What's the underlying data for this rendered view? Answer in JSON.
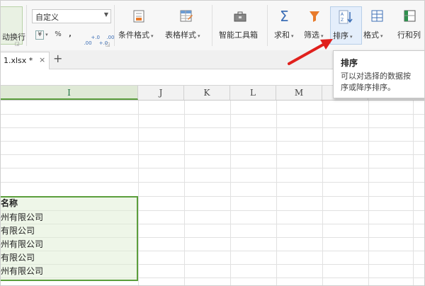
{
  "ribbon": {
    "wrap_label": "动换行",
    "number_format_value": "自定义",
    "currency_symbol": "¥",
    "percent_symbol": "%",
    "comma_symbol": ",",
    "inc_decimal": "+.0\n.00",
    "dec_decimal": ".00\n+.0",
    "conditional_format_label": "条件格式",
    "table_style_label": "表格样式",
    "smart_toolbox_label": "智能工具箱",
    "sum_label": "求和",
    "filter_label": "筛选",
    "sort_label": "排序",
    "format_label": "格式",
    "row_col_label": "行和列"
  },
  "tooltip": {
    "title": "排序",
    "description": "可以对选择的数据按\n序或降序排序。"
  },
  "tabs": {
    "file_name": "1.xlsx *",
    "close_glyph": "×",
    "new_tab_glyph": "+"
  },
  "columns": [
    {
      "label": "I"
    },
    {
      "label": "J"
    },
    {
      "label": "K"
    },
    {
      "label": "L"
    },
    {
      "label": "M"
    }
  ],
  "cells": {
    "header": "名称",
    "rows": [
      "州有限公司",
      "有限公司",
      "州有限公司",
      "有限公司",
      "州有限公司"
    ]
  },
  "colors": {
    "selection_border": "#5b9e3c",
    "annotation_arrow": "#e0201c",
    "active_button": "#e4eefb"
  }
}
